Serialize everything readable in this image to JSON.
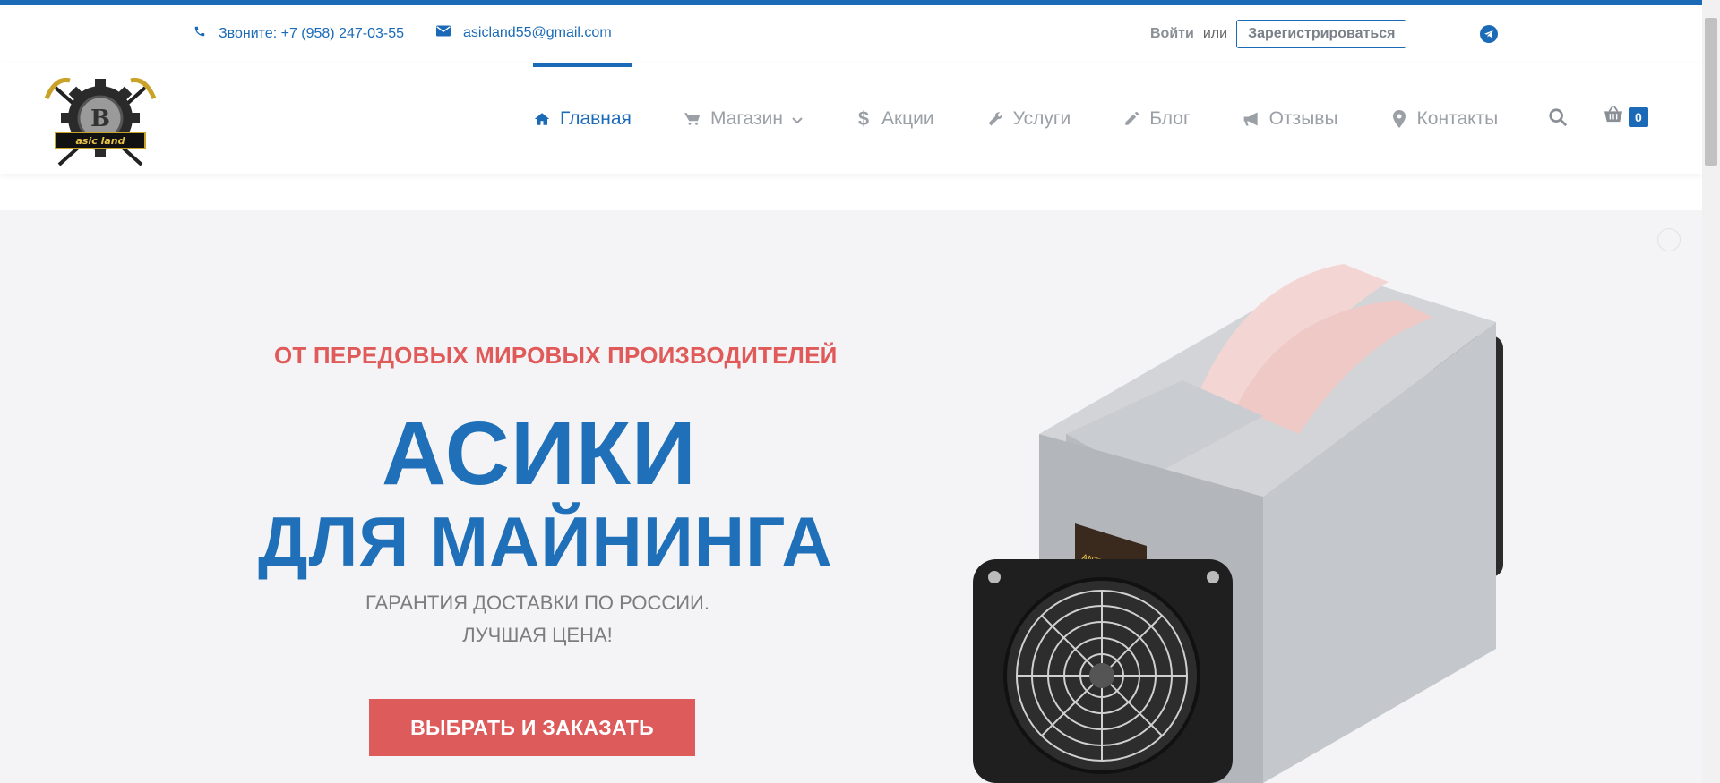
{
  "topbar": {
    "phone": "Звоните: +7 (958) 247-03-55",
    "email": "asicland55@gmail.com",
    "login": "Войти",
    "or": "или",
    "register": "Зарегистрироваться"
  },
  "logo": {
    "text": "asic land",
    "letter": "B"
  },
  "nav": {
    "items": [
      {
        "label": "Главная",
        "icon": "home-icon",
        "active": true
      },
      {
        "label": "Магазин",
        "icon": "cart-icon",
        "dropdown": true
      },
      {
        "label": "Акции",
        "icon": "dollar-icon"
      },
      {
        "label": "Услуги",
        "icon": "wrench-icon"
      },
      {
        "label": "Блог",
        "icon": "pencil-icon"
      },
      {
        "label": "Отзывы",
        "icon": "megaphone-icon"
      },
      {
        "label": "Контакты",
        "icon": "map-marker-icon"
      }
    ],
    "cart_count": "0"
  },
  "hero": {
    "subtitle": "ОТ ПЕРЕДОВЫХ МИРОВЫХ ПРОИЗВОДИТЕЛЕЙ",
    "title_line1": "АСИКИ",
    "title_line2": "ДЛЯ МАЙНИНГА",
    "text_line1": "ГАРАНТИЯ ДОСТАВКИ ПО РОССИИ.",
    "text_line2": "ЛУЧШАЯ ЦЕНА!",
    "cta": "ВЫБРАТЬ И ЗАКАЗАТЬ",
    "product_label": "ANTMINER L3+"
  },
  "colors": {
    "brand_blue": "#1a6ab8",
    "accent_red": "#dd5b5b",
    "hero_bg": "#f4f4f6"
  }
}
